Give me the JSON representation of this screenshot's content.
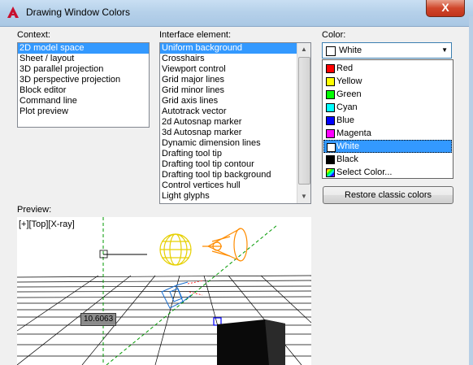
{
  "window": {
    "title": "Drawing Window Colors",
    "close_glyph": "X"
  },
  "context": {
    "label": "Context:",
    "items": [
      "2D model space",
      "Sheet / layout",
      "3D parallel projection",
      "3D perspective projection",
      "Block editor",
      "Command line",
      "Plot preview"
    ],
    "selected_index": 0
  },
  "interface": {
    "label": "Interface element:",
    "items": [
      "Uniform background",
      "Crosshairs",
      "Viewport control",
      "Grid major lines",
      "Grid minor lines",
      "Grid axis lines",
      "Autotrack vector",
      "2d Autosnap marker",
      "3d Autosnap marker",
      "Dynamic dimension lines",
      "Drafting tool tip",
      "Drafting tool tip contour",
      "Drafting tool tip background",
      "Control vertices hull",
      "Light glyphs"
    ],
    "selected_index": 0
  },
  "color": {
    "label": "Color:",
    "selected": "White",
    "selected_swatch": "#ffffff",
    "options": [
      {
        "label": "Red",
        "swatch": "#ff0000"
      },
      {
        "label": "Yellow",
        "swatch": "#ffff00"
      },
      {
        "label": "Green",
        "swatch": "#00ff00"
      },
      {
        "label": "Cyan",
        "swatch": "#00ffff"
      },
      {
        "label": "Blue",
        "swatch": "#0000ff"
      },
      {
        "label": "Magenta",
        "swatch": "#ff00ff"
      },
      {
        "label": "White",
        "swatch": "#ffffff"
      },
      {
        "label": "Black",
        "swatch": "#000000"
      },
      {
        "label": "Select Color...",
        "swatch": "multicolor"
      }
    ],
    "highlighted_index": 6
  },
  "restore_button": "Restore classic colors",
  "preview": {
    "label": "Preview:",
    "viewport_label": "[+][Top][X-ray]",
    "dimension_value": "10.6063"
  },
  "colors": {
    "selection": "#3399ff",
    "titlebar": "#b6d1ea",
    "dialog": "#f0f0f0"
  }
}
